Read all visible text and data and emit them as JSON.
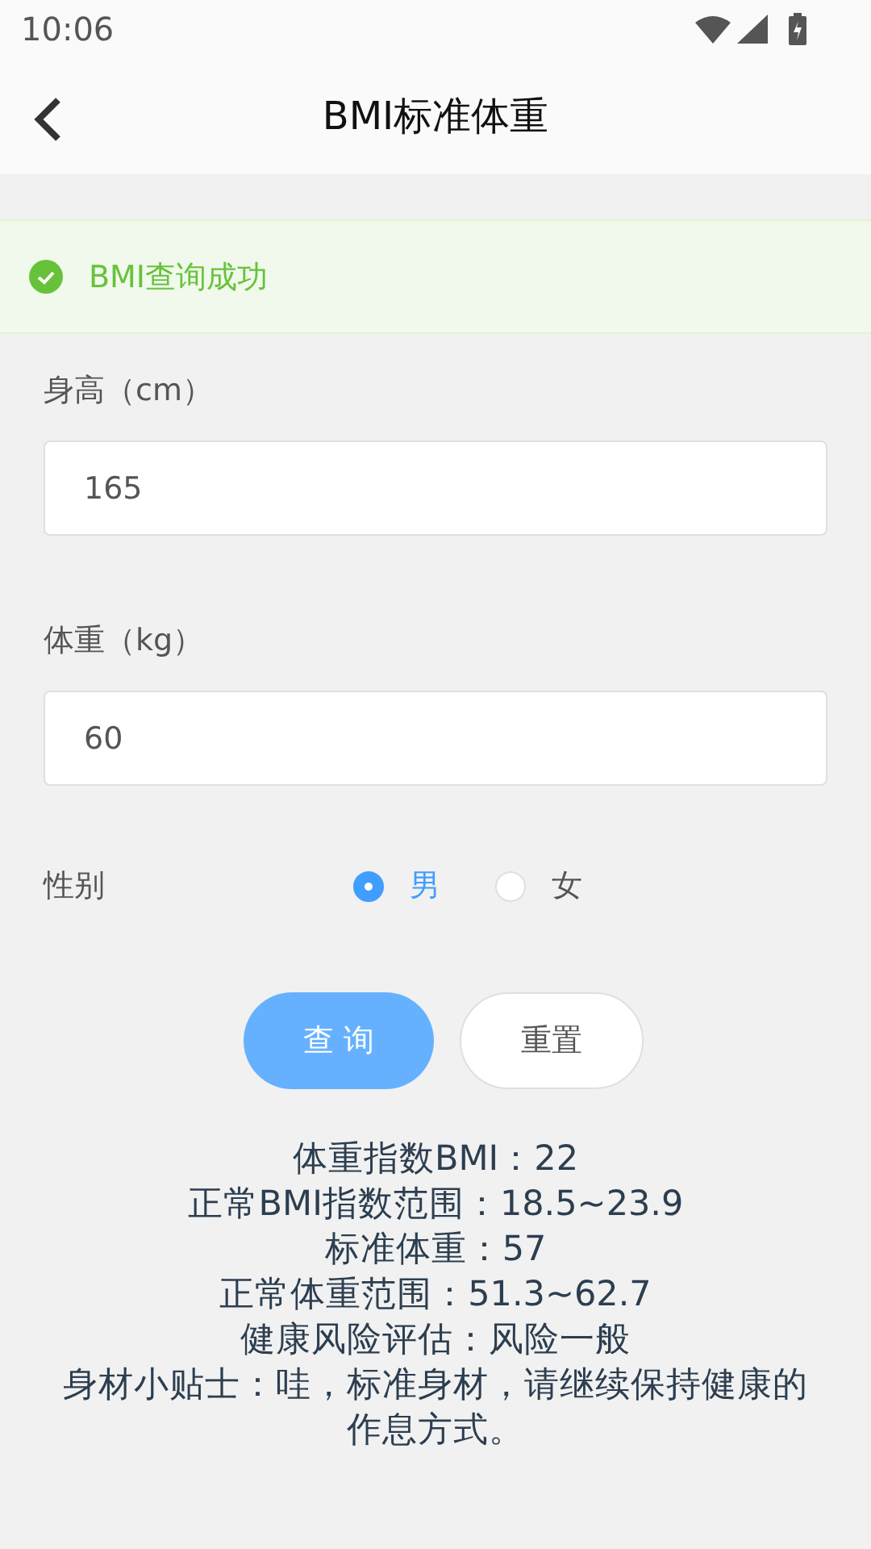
{
  "status_bar": {
    "time": "10:06"
  },
  "header": {
    "title": "BMI标准体重"
  },
  "toast": {
    "message": "BMI查询成功"
  },
  "fields": [
    {
      "label": "身高（cm）",
      "value": "165"
    },
    {
      "label": "体重（kg）",
      "value": "60"
    }
  ],
  "gender": {
    "label": "性别",
    "options": [
      {
        "label": "男",
        "selected": true
      },
      {
        "label": "女",
        "selected": false
      }
    ]
  },
  "buttons": [
    {
      "label": "查 询",
      "kind": "primary"
    },
    {
      "label": "重置",
      "kind": "plain"
    }
  ],
  "results": [
    "体重指数BMI：22",
    "正常BMI指数范围：18.5~23.9",
    "标准体重：57",
    "正常体重范围：51.3~62.7",
    "健康风险评估：风险一般",
    "身材小贴士：哇，标准身材，请继续保持健康的作息方式。"
  ]
}
